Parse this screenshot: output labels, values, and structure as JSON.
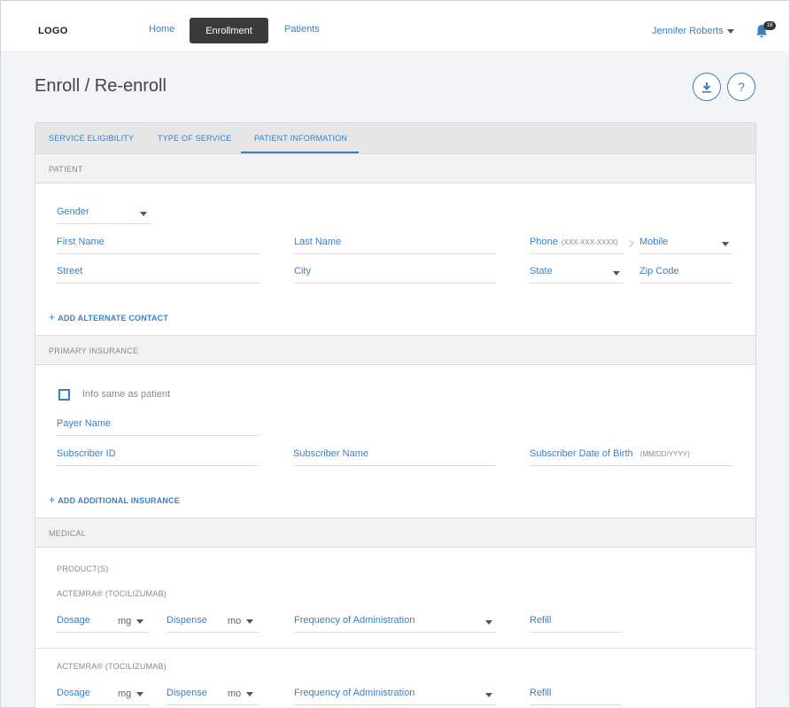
{
  "header": {
    "logo": "LOGO",
    "nav": {
      "home": "Home",
      "enrollment": "Enrollment",
      "patients": "Patients"
    },
    "user": "Jennifer Roberts",
    "notifications": "18"
  },
  "page": {
    "title": "Enroll / Re-enroll",
    "help": "?"
  },
  "tabs": {
    "service_eligibility": "SERVICE ELIGIBILITY",
    "type_of_service": "TYPE OF SERVICE",
    "patient_information": "PATIENT INFORMATION"
  },
  "patient": {
    "header": "PATIENT",
    "gender": "Gender",
    "first_name": "First Name",
    "last_name": "Last Name",
    "phone": "Phone",
    "phone_hint": "(XXX-XXX-XXXX)",
    "phone_type": "Mobile",
    "street": "Street",
    "city": "City",
    "state": "State",
    "zip": "Zip Code",
    "add_contact": "ADD ALTERNATE CONTACT"
  },
  "insurance": {
    "header": "PRIMARY INSURANCE",
    "same_as_patient": "Info same as patient",
    "payer_name": "Payer Name",
    "subscriber_id": "Subscriber ID",
    "subscriber_name": "Subscriber Name",
    "subscriber_dob": "Subscriber Date of Birth",
    "dob_hint": "(MM/DD/YYYY)",
    "add_insurance": "ADD ADDITIONAL INSURANCE"
  },
  "medical": {
    "header": "MEDICAL",
    "products_label": "PRODUCT(S)",
    "products": [
      {
        "name": "ACTEMRA® (TOCILIZUMAB)",
        "dosage": "Dosage",
        "dosage_unit": "mg",
        "dispense": "Dispense",
        "dispense_unit": "mo",
        "frequency": "Frequency of Administration",
        "refill": "Refill"
      },
      {
        "name": "ACTEMRA® (TOCILIZUMAB)",
        "dosage": "Dosage",
        "dosage_unit": "mg",
        "dispense": "Dispense",
        "dispense_unit": "mo",
        "frequency": "Frequency of Administration",
        "refill": "Refill"
      }
    ]
  },
  "colors": {
    "accent": "#3a7fc4",
    "nav_active": "#3b3b3b"
  }
}
